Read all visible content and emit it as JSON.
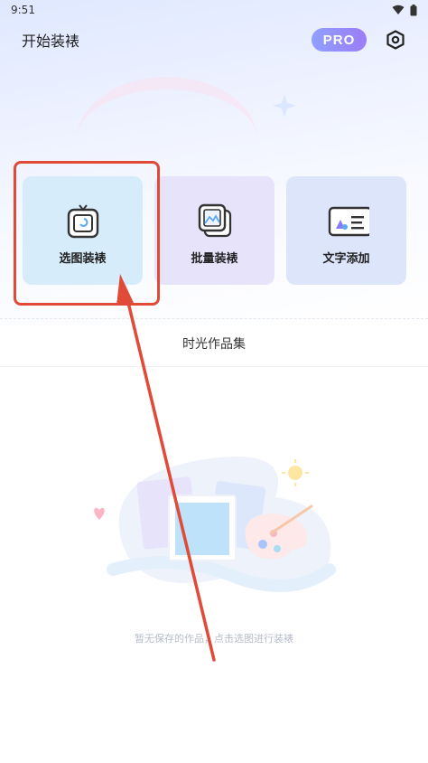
{
  "status_bar": {
    "time": "9:51"
  },
  "header": {
    "title": "开始装裱",
    "pro_label": "PRO"
  },
  "cards": [
    {
      "label": "选图装裱",
      "icon": "frame-photo-icon"
    },
    {
      "label": "批量装裱",
      "icon": "stacked-photos-icon"
    },
    {
      "label": "文字添加",
      "icon": "text-card-icon"
    }
  ],
  "section": {
    "title": "时光作品集"
  },
  "empty_state": {
    "message": "暂无保存的作品，点击选图进行装裱"
  },
  "colors": {
    "highlight": "#e04a36",
    "pro_gradient_start": "#8fa0ff",
    "pro_gradient_end": "#9c7cf7"
  }
}
